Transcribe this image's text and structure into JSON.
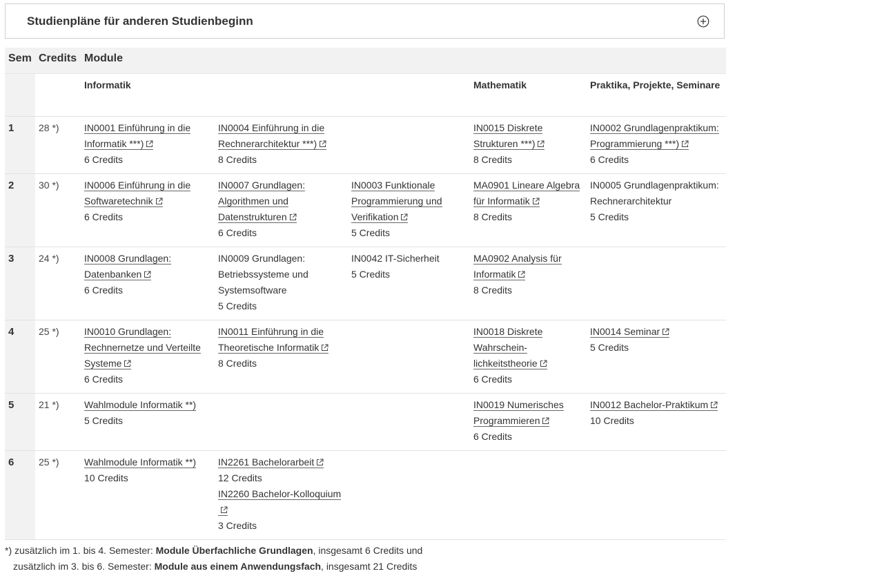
{
  "accordion": {
    "title": "Studienpläne für anderen Studienbeginn"
  },
  "table": {
    "headers": {
      "sem": "Sem",
      "credits": "Credits",
      "modules": "Module"
    },
    "groups": {
      "informatik": "Informatik",
      "mathematik": "Mathematik",
      "praktika": "Praktika, Projekte, Seminare"
    },
    "rows": [
      {
        "sem": "1",
        "credits": "28 *)",
        "c1": [
          {
            "name": "IN0001 Einführung in die Informatik ***)",
            "link": true,
            "credits": "6 Credits"
          }
        ],
        "c2": [
          {
            "name": "IN0004 Einführung in die Rechnerarchitektur ***)",
            "link": true,
            "credits": "8 Credits"
          }
        ],
        "c3": [],
        "math": [
          {
            "name": "IN0015 Diskrete Strukturen ***)",
            "link": true,
            "credits": "8 Credits"
          }
        ],
        "prak": [
          {
            "name": "IN0002 Grundlagenpraktikum: Programmierung ***)",
            "link": true,
            "credits": "6 Credits"
          }
        ]
      },
      {
        "sem": "2",
        "credits": "30 *)",
        "c1": [
          {
            "name": "IN0006 Einführung in die Softwaretechnik",
            "link": true,
            "credits": "6 Credits"
          }
        ],
        "c2": [
          {
            "name": "IN0007 Grundlagen: Algorithmen und Datenstrukturen",
            "link": true,
            "credits": "6 Credits"
          }
        ],
        "c3": [
          {
            "name": "IN0003 Funktionale Programmierung und Verifikation",
            "link": true,
            "credits": "5 Credits"
          }
        ],
        "math": [
          {
            "name": "MA0901 Lineare Algebra für Informatik",
            "link": true,
            "credits": "8 Credits"
          }
        ],
        "prak": [
          {
            "name": "IN0005 Grundlagenpraktikum: Rechnerarchitektur",
            "link": false,
            "credits": "5 Credits"
          }
        ]
      },
      {
        "sem": "3",
        "credits": "24 *)",
        "c1": [
          {
            "name": "IN0008 Grundlagen: Datenbanken",
            "link": true,
            "credits": "6 Credits"
          }
        ],
        "c2": [
          {
            "name": "IN0009 Grundlagen: Betriebssysteme und Systemsoftware",
            "link": false,
            "credits": "5 Credits"
          }
        ],
        "c3": [
          {
            "name": "IN0042 IT-Sicherheit",
            "link": false,
            "credits": "5 Credits"
          }
        ],
        "math": [
          {
            "name": "MA0902 Analysis für Informatik",
            "link": true,
            "credits": "8 Credits"
          }
        ],
        "prak": []
      },
      {
        "sem": "4",
        "credits": "25 *)",
        "c1": [
          {
            "name": "IN0010 Grundlagen: Rechnernetze und Verteilte Systeme",
            "link": true,
            "credits": "6 Credits"
          }
        ],
        "c2": [
          {
            "name": "IN0011 Einführung in die Theoretische Informatik",
            "link": true,
            "credits": "8 Credits"
          }
        ],
        "c3": [],
        "math": [
          {
            "name": "IN0018 Diskrete Wahrschein-lichkeitstheorie",
            "link": true,
            "credits": "6 Credits"
          }
        ],
        "prak": [
          {
            "name": "IN0014 Seminar",
            "link": true,
            "credits": "5 Credits"
          }
        ]
      },
      {
        "sem": "5",
        "credits": "21 *)",
        "c1": [
          {
            "name": "Wahlmodule Informatik **)",
            "link": "plain",
            "credits": "5 Credits"
          }
        ],
        "c2": [],
        "c3": [],
        "math": [
          {
            "name": "IN0019 Numerisches Programmieren",
            "link": true,
            "credits": "6 Credits"
          }
        ],
        "prak": [
          {
            "name": "IN0012 Bachelor-Praktikum",
            "link": true,
            "credits": "10 Credits"
          }
        ]
      },
      {
        "sem": "6",
        "credits": "25 *)",
        "c1": [
          {
            "name": "Wahlmodule Informatik **)",
            "link": "plain",
            "credits": "10 Credits"
          }
        ],
        "c2": [
          {
            "name": "IN2261 Bachelorarbeit",
            "link": true,
            "credits": "12 Credits"
          },
          {
            "name": "IN2260 Bachelor-Kolloquium",
            "link": true,
            "credits": "3 Credits"
          }
        ],
        "c3": [],
        "math": [],
        "prak": []
      }
    ]
  },
  "footnote": {
    "l1_pre": "*) zusätzlich im 1. bis 4. Semester: ",
    "l1_bold": "Module Überfachliche Grundlagen",
    "l1_post": ", insgesamt 6 Credits und",
    "l2_pre": "zusätzlich im 3. bis 6. Semester: ",
    "l2_bold": "Module aus einem Anwendungsfach",
    "l2_post": ", insgesamt 21 Credits"
  }
}
